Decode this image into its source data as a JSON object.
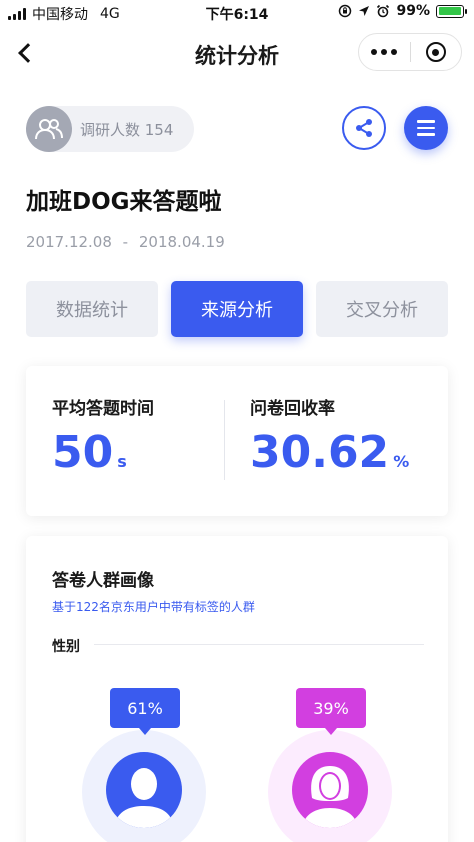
{
  "status_bar": {
    "carrier": "中国移动",
    "network": "4G",
    "time": "下午6:14",
    "battery": "99%",
    "battery_level": 0.99,
    "battery_color": "#33c648"
  },
  "nav": {
    "title": "统计分析",
    "back_icon": "chevron-left-icon",
    "more_icon": "more-dots-icon",
    "close_icon": "target-close-icon"
  },
  "respondents": {
    "label": "调研人数 154",
    "icon": "people-icon"
  },
  "actions": {
    "share_icon": "share-icon",
    "menu_icon": "menu-icon"
  },
  "survey": {
    "title": "加班DOG来答题啦",
    "date_start": "2017.12.08",
    "date_sep": "-",
    "date_end": "2018.04.19"
  },
  "tabs": [
    {
      "label": "数据统计",
      "active": false
    },
    {
      "label": "来源分析",
      "active": true
    },
    {
      "label": "交叉分析",
      "active": false
    }
  ],
  "stats": {
    "avg_time_label": "平均答题时间",
    "avg_time_value": "50",
    "avg_time_unit": "s",
    "recovery_label": "问卷回收率",
    "recovery_value": "30.62",
    "recovery_unit": "%"
  },
  "profile": {
    "title": "答卷人群画像",
    "subtitle": "基于122名京东用户中带有标签的人群",
    "gender_label": "性别",
    "male_pct": "61%",
    "female_pct": "39%",
    "male_icon": "male-avatar-icon",
    "female_icon": "female-avatar-icon"
  },
  "colors": {
    "primary": "#3a5bef",
    "female": "#d23fe0",
    "male_halo": "#eef1fd",
    "female_halo": "#fcecfe"
  }
}
